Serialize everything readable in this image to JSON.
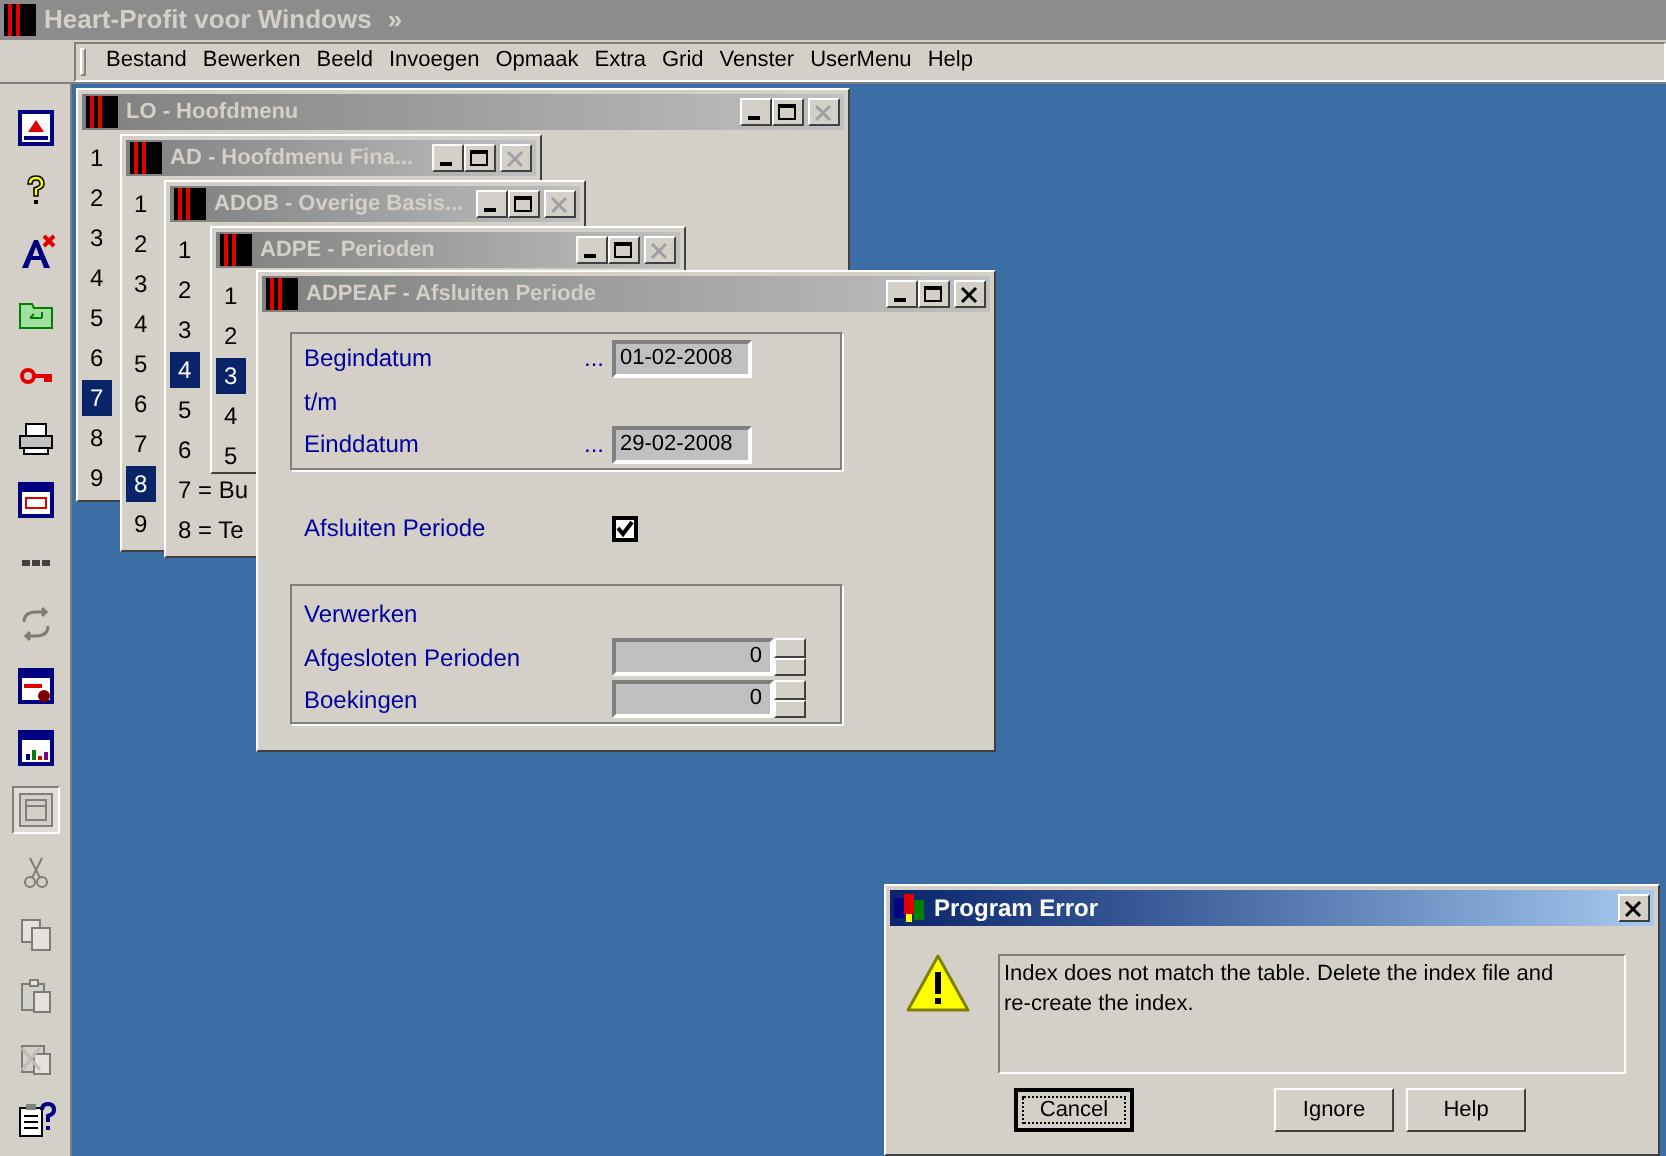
{
  "app_title": "Heart-Profit voor Windows",
  "app_title_chevron": "»",
  "menu": [
    "Bestand",
    "Bewerken",
    "Beeld",
    "Invoegen",
    "Opmaak",
    "Extra",
    "Grid",
    "Venster",
    "UserMenu",
    "Help"
  ],
  "toolbar": [
    {
      "kind": "exit",
      "disabled": false,
      "pressed": false
    },
    {
      "kind": "help",
      "disabled": false,
      "pressed": false
    },
    {
      "kind": "font-delete",
      "disabled": false,
      "pressed": false
    },
    {
      "kind": "folder",
      "disabled": false,
      "pressed": false
    },
    {
      "kind": "key",
      "disabled": false,
      "pressed": false
    },
    {
      "kind": "print",
      "disabled": false,
      "pressed": false
    },
    {
      "kind": "window",
      "disabled": false,
      "pressed": false
    },
    {
      "kind": "dots",
      "disabled": false,
      "pressed": false
    },
    {
      "kind": "refresh",
      "disabled": true,
      "pressed": false
    },
    {
      "kind": "window-lock",
      "disabled": false,
      "pressed": false
    },
    {
      "kind": "chart",
      "disabled": false,
      "pressed": false
    },
    {
      "kind": "frame",
      "disabled": false,
      "pressed": true
    },
    {
      "kind": "cut",
      "disabled": true,
      "pressed": false
    },
    {
      "kind": "copy",
      "disabled": true,
      "pressed": false
    },
    {
      "kind": "paste",
      "disabled": true,
      "pressed": false
    },
    {
      "kind": "paste-delete",
      "disabled": true,
      "pressed": false
    },
    {
      "kind": "properties-help",
      "disabled": false,
      "pressed": false
    }
  ],
  "menu_windows": [
    {
      "title": "LO - Hoofdmenu",
      "close_disabled": true,
      "items": [
        {
          "text": "1",
          "selected": false
        },
        {
          "text": "2",
          "selected": false
        },
        {
          "text": "3",
          "selected": false
        },
        {
          "text": "4",
          "selected": false
        },
        {
          "text": "5",
          "selected": false
        },
        {
          "text": "6",
          "selected": false
        },
        {
          "text": "7",
          "selected": true
        },
        {
          "text": "8",
          "selected": false
        },
        {
          "text": "9",
          "selected": false
        }
      ]
    },
    {
      "title": "AD - Hoofdmenu Fina...",
      "close_disabled": true,
      "items": [
        {
          "text": "1",
          "selected": false
        },
        {
          "text": "2",
          "selected": false
        },
        {
          "text": "3",
          "selected": false
        },
        {
          "text": "4",
          "selected": false
        },
        {
          "text": "5",
          "selected": false
        },
        {
          "text": "6",
          "selected": false
        },
        {
          "text": "7",
          "selected": false
        },
        {
          "text": "8",
          "selected": true
        },
        {
          "text": "9",
          "selected": false
        }
      ]
    },
    {
      "title": "ADOB - Overige Basis...",
      "close_disabled": true,
      "items": [
        {
          "text": "1",
          "selected": false
        },
        {
          "text": "2",
          "selected": false
        },
        {
          "text": "3",
          "selected": false
        },
        {
          "text": "4",
          "selected": true
        },
        {
          "text": "5",
          "selected": false
        },
        {
          "text": "6",
          "selected": false
        },
        {
          "text": "7 = Bu",
          "selected": false
        },
        {
          "text": "8 = Te",
          "selected": false
        }
      ]
    },
    {
      "title": "ADPE - Perioden",
      "close_disabled": true,
      "items": [
        {
          "text": "1",
          "selected": false
        },
        {
          "text": "2",
          "selected": false
        },
        {
          "text": "3",
          "selected": true
        },
        {
          "text": "4",
          "selected": false
        },
        {
          "text": "5",
          "selected": false
        }
      ]
    }
  ],
  "form_window": {
    "title": "ADPEAF - Afsluiten Periode",
    "close_disabled": false,
    "begindatum": {
      "label": "Begindatum",
      "dots": "...",
      "value": "01-02-2008"
    },
    "tm": "t/m",
    "einddatum": {
      "label": "Einddatum",
      "dots": "...",
      "value": "29-02-2008"
    },
    "afsluiten": {
      "label": "Afsluiten Periode",
      "checked": true
    },
    "verwerken": "Verwerken",
    "counters": [
      {
        "label": "Afgesloten Perioden",
        "value": "0"
      },
      {
        "label": "Boekingen",
        "value": "0"
      }
    ]
  },
  "error_dialog": {
    "title": "Program Error",
    "message": "Index does not match the table. Delete the index file and re-create the index.",
    "buttons": [
      {
        "label": "Cancel",
        "focused": true
      },
      {
        "label": "Ignore",
        "focused": false
      },
      {
        "label": "Help",
        "focused": false
      }
    ]
  }
}
